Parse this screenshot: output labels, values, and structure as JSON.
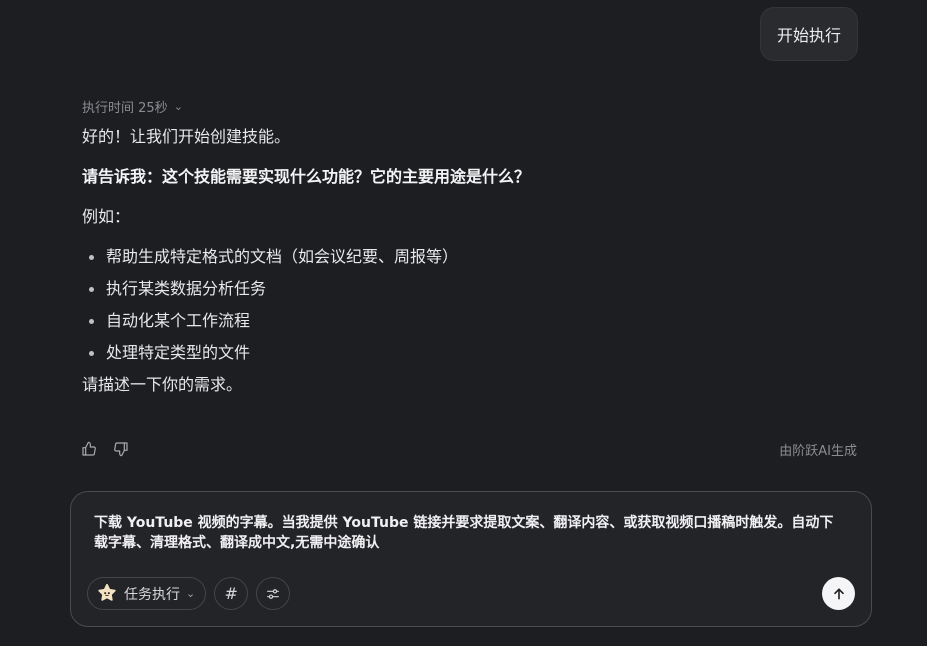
{
  "user_message": "开始执行",
  "assistant": {
    "meta_label": "执行时间 25秒",
    "p1": "好的！让我们开始创建技能。",
    "p2": "请告诉我：这个技能需要实现什么功能？它的主要用途是什么？",
    "p3": "例如：",
    "examples": [
      "帮助生成特定格式的文档（如会议纪要、周报等）",
      "执行某类数据分析任务",
      "自动化某个工作流程",
      "处理特定类型的文件"
    ],
    "p4": "请描述一下你的需求。"
  },
  "footer_note": "由阶跃AI生成",
  "composer": {
    "text": "下载 YouTube 视频的字幕。当我提供 YouTube 链接并要求提取文案、翻译内容、或获取视频口播稿时触发。自动下载字幕、清理格式、翻译成中文,无需中途确认",
    "mode_label": "任务执行",
    "hash_label": "#"
  },
  "icons": {
    "thumb_up": "thumb-up-icon",
    "thumb_down": "thumb-down-icon",
    "chevron": "chevron-down-icon",
    "sliders": "sliders-icon",
    "send": "arrow-up-icon",
    "mascot": "mascot-icon"
  },
  "colors": {
    "background": "#1d1e21",
    "bubble": "#2a2b2f",
    "composer": "#232428",
    "send_button": "#f5f5f7"
  }
}
